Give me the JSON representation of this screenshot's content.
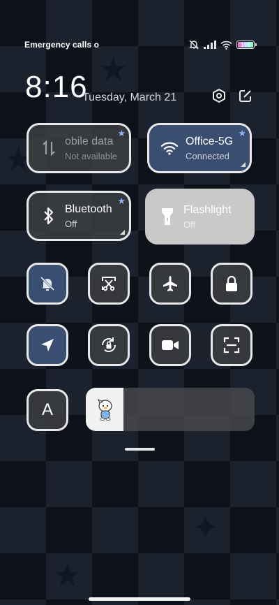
{
  "status_bar": {
    "left_text": "Emergency calls o",
    "battery_level": "100",
    "icons": [
      "do-not-disturb-off-icon",
      "signal-icon",
      "wifi-icon",
      "battery-icon"
    ]
  },
  "header": {
    "time": "8:16",
    "date": "Tuesday, March 21",
    "icons": [
      "settings-hex-icon",
      "edit-icon"
    ]
  },
  "tiles": [
    {
      "title": "obile data",
      "subtitle": "Not available",
      "icon": "mobile-data-icon",
      "state": "disabled"
    },
    {
      "title": "Office-5G",
      "subtitle": "Connected",
      "icon": "wifi-icon",
      "state": "active"
    },
    {
      "title": "Bluetooth",
      "subtitle": "Off",
      "icon": "bluetooth-icon",
      "state": "off"
    },
    {
      "title": "Flashlight",
      "subtitle": "Off",
      "icon": "flashlight-icon",
      "state": "off"
    }
  ],
  "toggles": [
    {
      "icon": "silent-bell-icon",
      "active": true
    },
    {
      "icon": "screenshot-scissors-icon",
      "active": false
    },
    {
      "icon": "airplane-icon",
      "active": false
    },
    {
      "icon": "lock-icon",
      "active": false
    },
    {
      "icon": "location-arrow-icon",
      "active": true
    },
    {
      "icon": "rotation-lock-icon",
      "active": false
    },
    {
      "icon": "video-camera-icon",
      "active": false
    },
    {
      "icon": "scan-icon",
      "active": false
    }
  ],
  "auto_brightness": {
    "label": "A"
  },
  "brightness": {
    "level": 0.22,
    "icon": "mascot-thumb-icon"
  }
}
